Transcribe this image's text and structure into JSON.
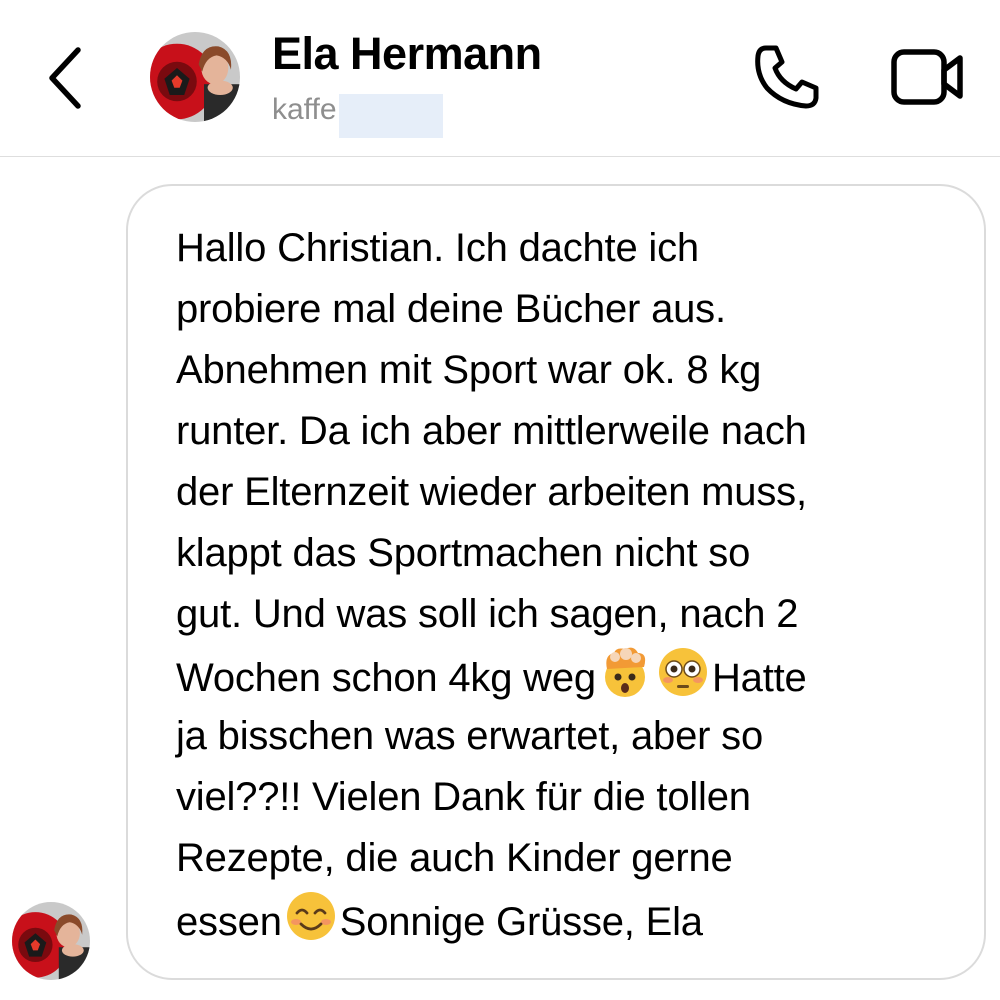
{
  "header": {
    "back_icon": "chevron-left-icon",
    "contact_name": "Ela Hermann",
    "contact_status": "kaffe",
    "call_icon": "phone-icon",
    "video_icon": "video-camera-icon"
  },
  "message": {
    "lines": [
      "Hallo Christian. Ich dachte ich",
      "probiere mal deine Bücher aus.",
      "Abnehmen mit Sport war ok. 8 kg",
      "runter. Da ich aber mittlerweile nach",
      "der Elternzeit wieder arbeiten muss,",
      "klappt das Sportmachen nicht so",
      "gut. Und was soll ich sagen, nach 2",
      "Wochen schon 4kg weg",
      "Hatte",
      "ja bisschen was erwartet, aber so",
      "viel??!! Vielen Dank für die tollen",
      "Rezepte, die auch Kinder gerne",
      "essen",
      "Sonnige Grüsse, Ela"
    ],
    "emojis": [
      "exploding-head-emoji",
      "flushed-face-emoji",
      "smiling-face-emoji"
    ]
  },
  "colors": {
    "bubble_border": "#dbdbdb",
    "status_text": "#8e8e8e",
    "redaction": "#e6eef9"
  }
}
